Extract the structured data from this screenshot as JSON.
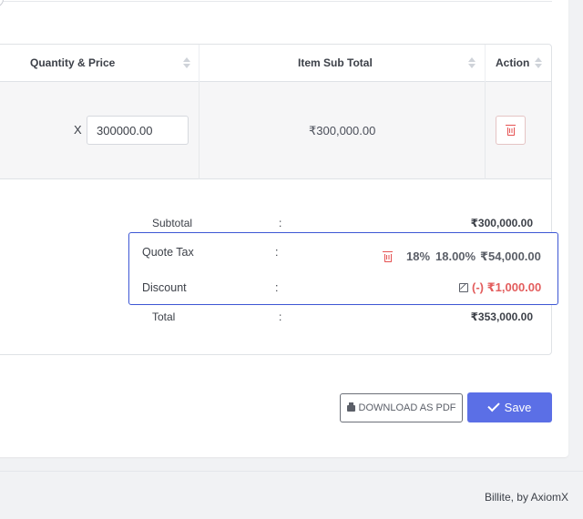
{
  "table": {
    "headers": {
      "quantity_price": "Quantity & Price",
      "item_sub_total": "Item Sub Total",
      "action": "Action"
    },
    "rows": [
      {
        "multiplier": "X",
        "price": "300000.00",
        "item_sub_total": "₹300,000.00"
      }
    ]
  },
  "summary": {
    "subtotal": {
      "label": "Subtotal",
      "colon": ":",
      "amount": "₹300,000.00"
    },
    "quote_tax": {
      "label": "Quote Tax",
      "colon": ":",
      "tax_name": "18%",
      "tax_rate": "18.00%",
      "amount": "₹54,000.00"
    },
    "discount": {
      "label": "Discount",
      "colon": ":",
      "amount": "(-) ₹1,000.00"
    },
    "total": {
      "label": "Total",
      "colon": ":",
      "amount": "₹353,000.00"
    }
  },
  "buttons": {
    "download_pdf": "DOWNLOAD AS PDF",
    "save": "Save"
  },
  "footer": {
    "text": "Billite, by AxiomX"
  },
  "colors": {
    "primary": "#5b6fe6",
    "danger": "#e55353",
    "highlight_border": "#3d57d4"
  },
  "icons": [
    "trash-icon",
    "edit-icon",
    "printer-icon",
    "check-icon",
    "sort-icon"
  ]
}
